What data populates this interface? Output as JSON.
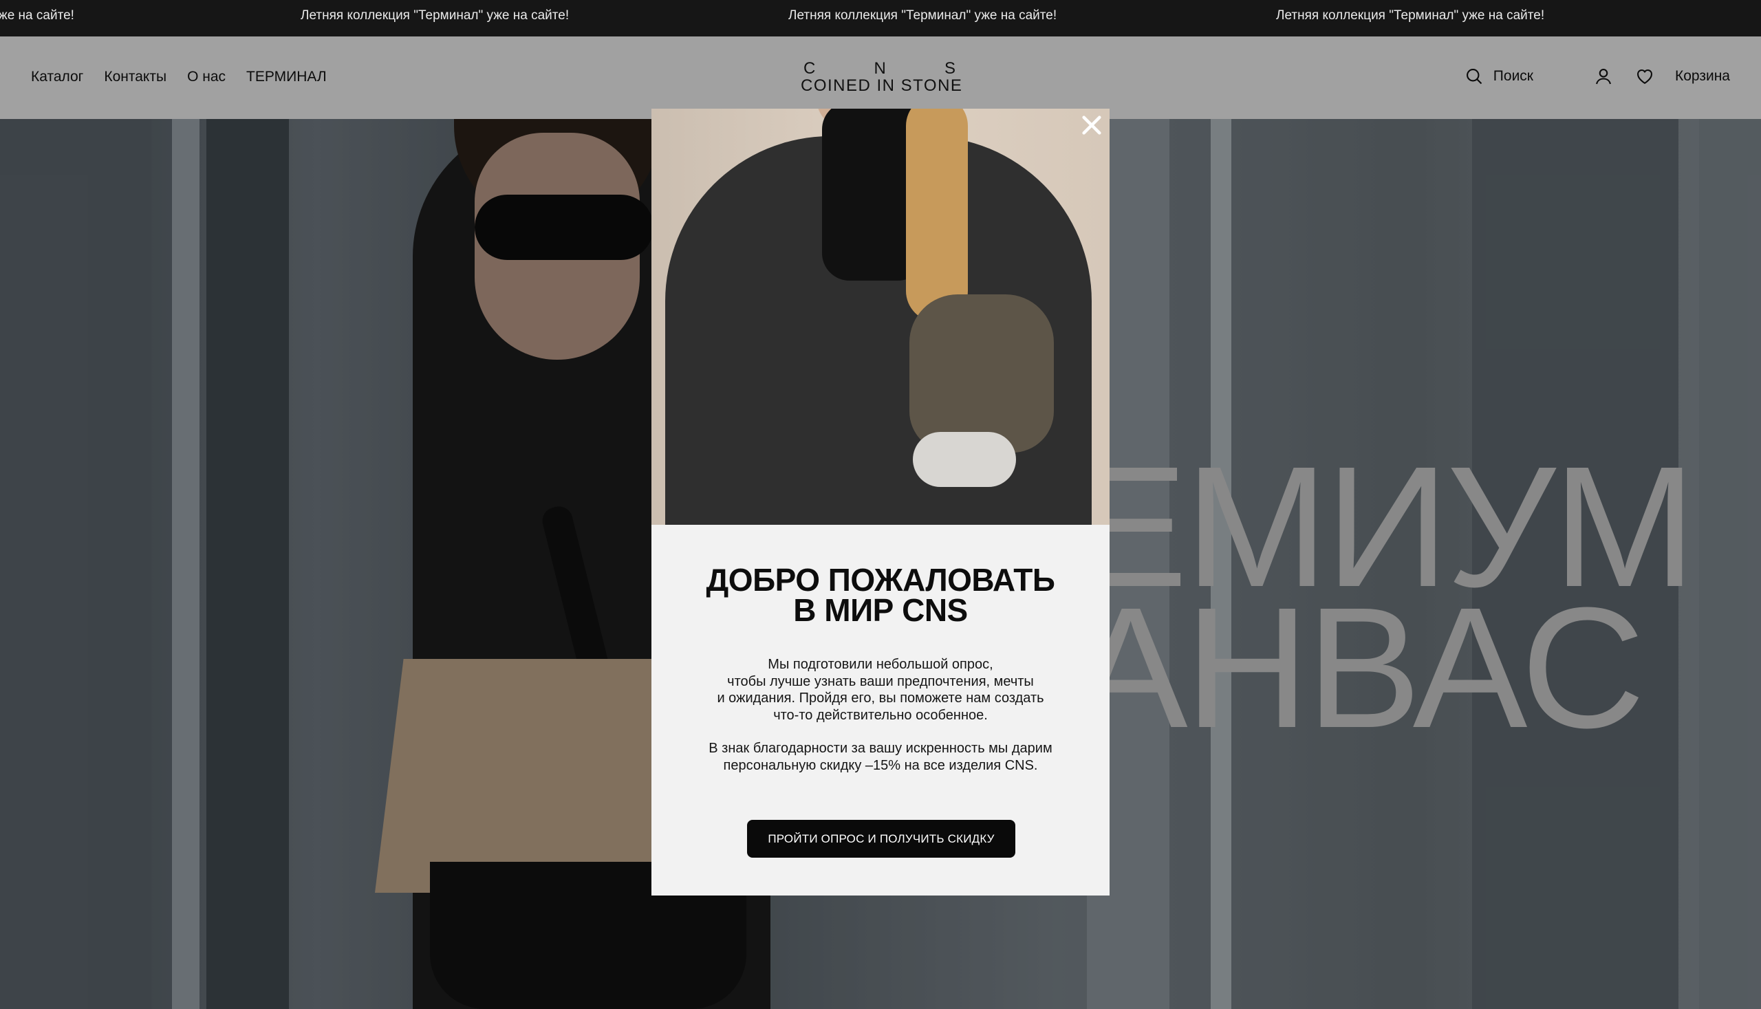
{
  "announcement": {
    "items": [
      "же на сайте!",
      "Летняя коллекция \"Терминал\" уже на сайте!",
      "Летняя коллекция \"Терминал\" уже на сайте!",
      "Летняя коллекция \"Терминал\" уже на сайте!"
    ]
  },
  "header": {
    "nav": [
      "Каталог",
      "Контакты",
      "О нас",
      "ТЕРМИНАЛ"
    ],
    "logo": {
      "letters": [
        "C",
        "N",
        "S"
      ],
      "name": "COINED IN STONE"
    },
    "search_label": "Поиск",
    "cart_label": "Корзина",
    "icons": [
      "search-icon",
      "account-icon",
      "heart-icon"
    ]
  },
  "hero": {
    "title_line1": "ЕМИУМ",
    "title_line2": "АНВАС"
  },
  "modal": {
    "title_line1": "ДОБРО ПОЖАЛОВАТЬ",
    "title_line2": "В МИР CNS",
    "text_lines": [
      "Мы подготовили небольшой опрос,",
      "чтобы лучше узнать ваши предпочтения, мечты",
      "и ожидания. Пройдя его, вы поможете нам создать",
      "что-то действительно особенное."
    ],
    "text2_lines": [
      "В знак благодарности за вашу искренность мы дарим",
      "персональную скидку –15% на все изделия CNS."
    ],
    "cta_label": "ПРОЙТИ ОПРОС И ПОЛУЧИТЬ СКИДКУ",
    "close_icon": "close-icon"
  },
  "colors": {
    "announcement_bg": "#161616",
    "header_bg": "#eeeeee",
    "modal_bg": "#f2f2f2",
    "cta_bg": "#0a0a0a"
  }
}
